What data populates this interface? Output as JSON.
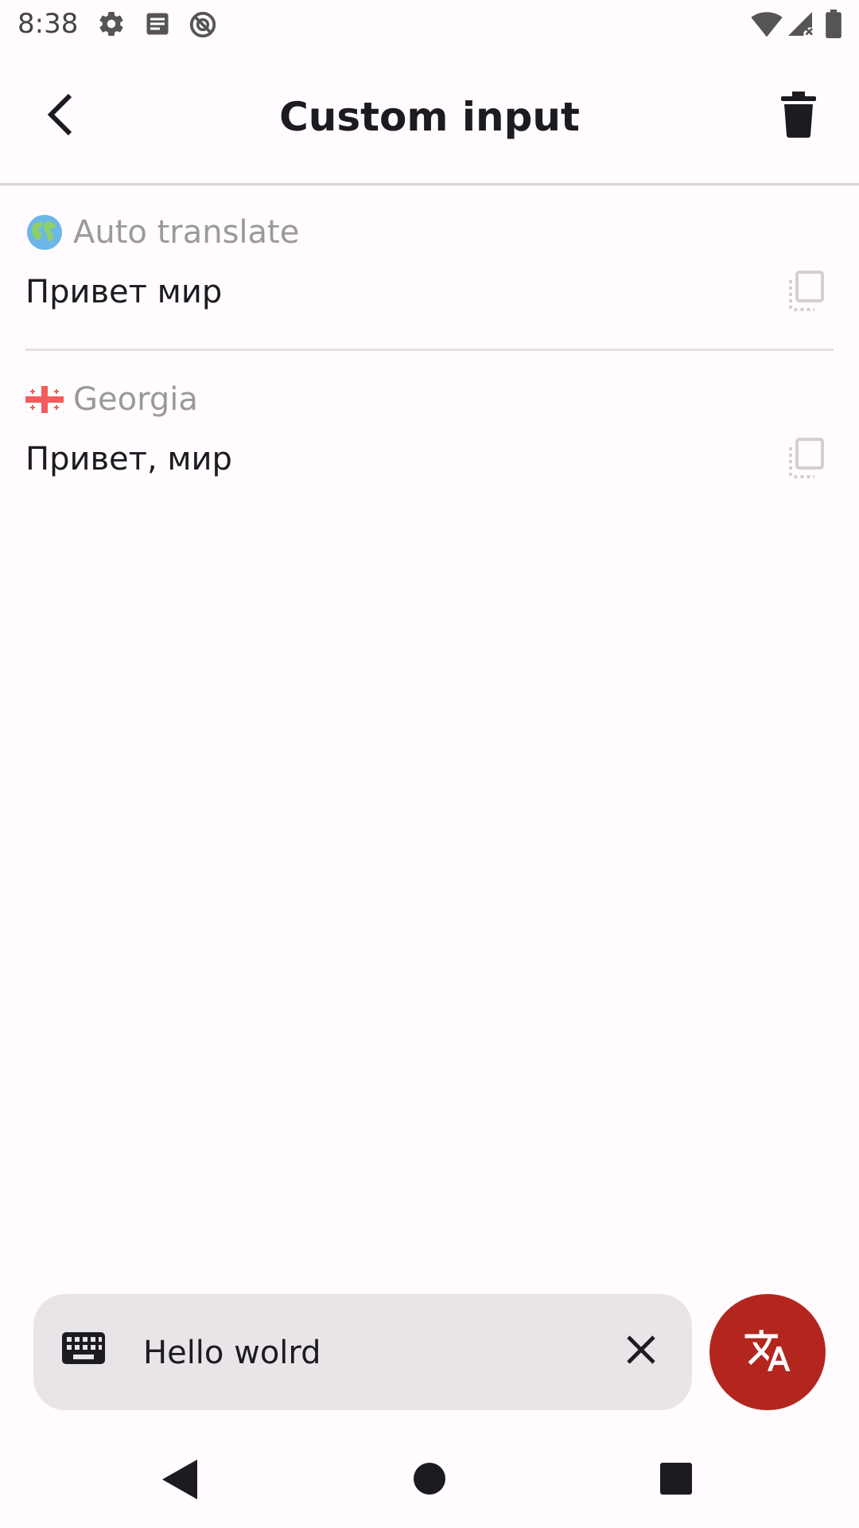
{
  "status_bar": {
    "time": "8:38",
    "icons": [
      "gear-icon",
      "notes-icon",
      "do-not-disturb-icon",
      "wifi-icon",
      "signal-icon",
      "battery-icon"
    ]
  },
  "app_bar": {
    "title": "Custom input",
    "back_icon": "chevron-left-icon",
    "delete_icon": "trash-icon"
  },
  "results": [
    {
      "emoji": "globe-icon",
      "language": "Auto translate",
      "text": "Привет мир",
      "copy_icon": "copy-icon"
    },
    {
      "emoji": "georgia-flag-icon",
      "language": "Georgia",
      "text": "Привет, мир",
      "copy_icon": "copy-icon"
    }
  ],
  "input": {
    "value": "Hello wolrd",
    "keyboard_icon": "keyboard-icon",
    "clear_icon": "close-icon"
  },
  "fab": {
    "icon": "translate-icon",
    "color": "#b3261e"
  },
  "nav_bar": {
    "icons": [
      "nav-back-icon",
      "nav-home-icon",
      "nav-recents-icon"
    ]
  }
}
